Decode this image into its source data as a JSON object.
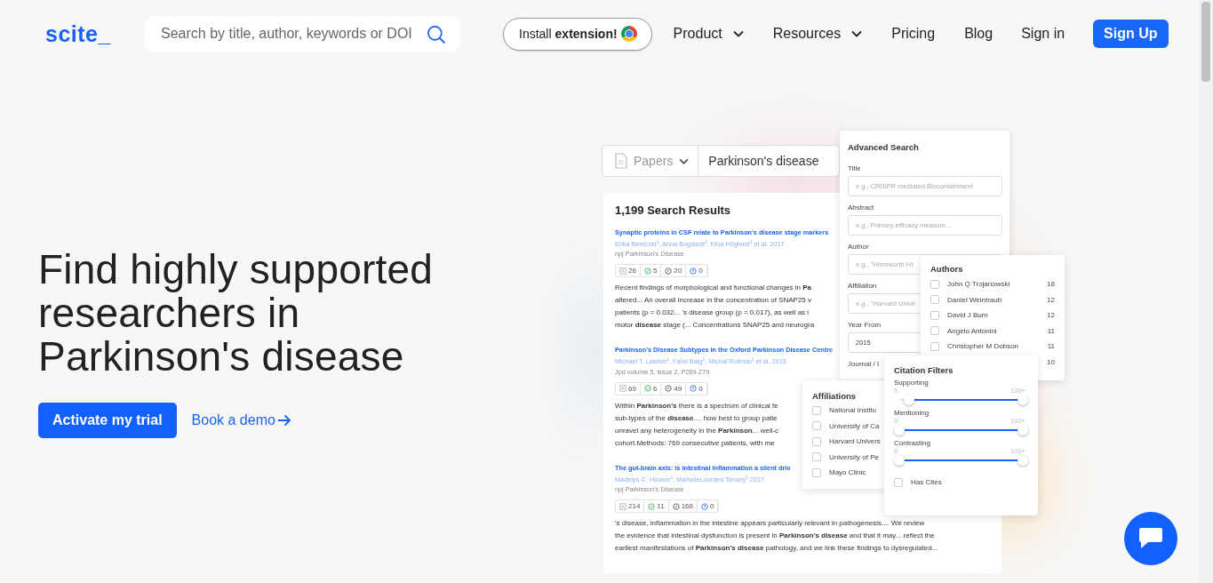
{
  "header": {
    "logo": "scite_",
    "search": {
      "placeholder": "Search by title, author, keywords or DOI"
    },
    "extension_button": "Install **extension!**",
    "nav": [
      {
        "label": "Product",
        "dropdown": true
      },
      {
        "label": "Resources",
        "dropdown": true
      },
      {
        "label": "Pricing",
        "dropdown": false
      },
      {
        "label": "Blog",
        "dropdown": false
      }
    ],
    "sign_in": "Sign in",
    "sign_up": "Sign Up"
  },
  "hero": {
    "headline_lines": [
      "Find highly supported",
      "researchers in",
      "Parkinson's disease"
    ],
    "primary_button": "Activate my trial",
    "secondary_link": "Book a demo"
  },
  "preview": {
    "search_bar": {
      "type_selector": "Papers",
      "query": "Parkinson's disease"
    },
    "results_title": "1,199 Search Results",
    "results": [
      {
        "title": "Synaptic proteins in CSF relate to Parkinson's disease stage markers",
        "authors": "Erika Bereczki$^{1}$, Anna Bogstedt$^{2}$, Kina Höglund$^{3}$ et al. 2017",
        "journal": "npj Parkinson's Disease",
        "counts": [
          {
            "kind": "publications",
            "value": "26"
          },
          {
            "kind": "supporting",
            "value": "5"
          },
          {
            "kind": "mentioning",
            "value": "20"
          },
          {
            "kind": "contrasting",
            "value": "0"
          }
        ],
        "abstract_lines": [
          "Recent findings of morphological and functional changes in **Pa**",
          "altered... An overall increase in the concentration of SNAP25 v",
          "patients (p = 0.032... 's disease group (p = 0.017), as well as i",
          "motor **disease** stage (... Concentrations SNAP25 and neurogra"
        ]
      },
      {
        "title": "Parkinson's Disease Subtypes in the Oxford Parkinson Disease Centre",
        "authors": "Michael T. Lawton$^{1}$, Fahd Baig$^{1}$, Michal Rolinski$^{1}$ et al. 2015",
        "journal": "Jpd volume 5, issue 2, P269-279",
        "counts": [
          {
            "kind": "publications",
            "value": "69"
          },
          {
            "kind": "supporting",
            "value": "6"
          },
          {
            "kind": "mentioning",
            "value": "49"
          },
          {
            "kind": "contrasting",
            "value": "0"
          }
        ],
        "abstract_lines": [
          "Within **Parkinson's** there is a spectrum of clinical fe",
          "sub-types of the **disease**.... how best to group patie",
          "unravel any heterogeneity in the **Parkinson**... well-c",
          "cohort.Methods: 769 consecutive patients, with me"
        ]
      },
      {
        "title": "The gut-brain axis: is intestinal inflammation a silent driv",
        "authors": "Madelyn C. Houser$^{1}$, MariadeLourdes Tansey$^{1}$ 2017",
        "journal": "npj Parkinson's Disease",
        "counts": [
          {
            "kind": "publications",
            "value": "214"
          },
          {
            "kind": "supporting",
            "value": "11"
          },
          {
            "kind": "mentioning",
            "value": "166"
          },
          {
            "kind": "contrasting",
            "value": "0"
          }
        ],
        "abstract_lines": [
          "'s disease, inflammation in the intestine appears particularly relevant in pathogenesis.... We review",
          "the evidence that intestinal dysfunction is present in **Parkinson's disease** and that it may... reflect the",
          "earliest manifestations of **Parkinson's disease** pathology, and we link these findings to dysregulated..."
        ]
      }
    ],
    "advanced_search": {
      "title": "Advanced Search",
      "fields": [
        {
          "label": "Title",
          "placeholder": "e.g., CRISPR mediated Biocontainment"
        },
        {
          "label": "Abstract",
          "placeholder": "e.g., Primary efficacy measure..."
        },
        {
          "label": "Author",
          "placeholder": "e.g., \"Himsworth HI"
        },
        {
          "label": "Affiliation",
          "placeholder": "e.g., \"Harvard Unive"
        },
        {
          "label": "Year From",
          "value": "2015"
        },
        {
          "label": "Journal / I"
        }
      ]
    },
    "authors_filter": {
      "title": "Authors",
      "items": [
        {
          "name": "John Q Trojanowski",
          "count": "18",
          "checked": false
        },
        {
          "name": "Daniel Weintraub",
          "count": "12",
          "checked": false
        },
        {
          "name": "David J Burn",
          "count": "12",
          "checked": false
        },
        {
          "name": "Angelo Antonini",
          "count": "11",
          "checked": false
        },
        {
          "name": "Christopher M Dobson",
          "count": "11",
          "checked": false
        },
        {
          "count": "10"
        }
      ]
    },
    "affiliations_filter": {
      "title": "Affiliations",
      "items": [
        {
          "name": "National Institu",
          "checked": false
        },
        {
          "name": "University of Ca",
          "checked": false
        },
        {
          "name": "Harvard Univers",
          "checked": false
        },
        {
          "name": "University of Pe",
          "checked": false
        },
        {
          "name": "Mayo Clinic",
          "checked": false
        }
      ]
    },
    "citation_filters": {
      "title": "Citation Filters",
      "sliders": [
        {
          "label": "Supporting",
          "min_label": "5",
          "max_label": "100+",
          "thumbs": [
            {
              "level": 0.08
            },
            {
              "level": 1
            }
          ]
        },
        {
          "label": "Mentioning",
          "min_label": "0",
          "max_label": "100+",
          "thumbs": [
            {
              "level": 0
            },
            {
              "level": 1
            }
          ]
        },
        {
          "label": "Contrasting",
          "min_label": "0",
          "max_label": "100+",
          "thumbs": [
            {
              "level": 0
            },
            {
              "level": 1
            }
          ]
        }
      ],
      "has_cites": {
        "label": "Has Cites",
        "checked": false
      }
    }
  }
}
